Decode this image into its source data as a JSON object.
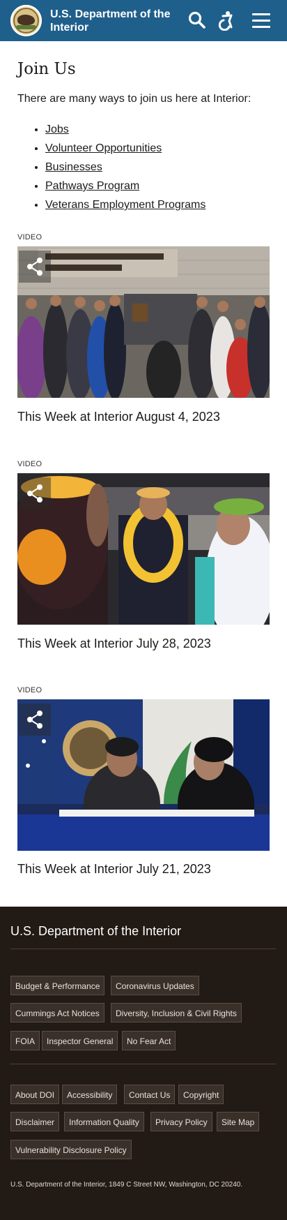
{
  "header": {
    "title": "U.S. Department of the Interior",
    "icons": [
      "seal-logo",
      "search-icon",
      "accessibility-icon",
      "menu-icon"
    ],
    "color": "#1f5f8b"
  },
  "main": {
    "heading": "Join Us",
    "intro": "There are many ways to join us here at Interior:",
    "links": [
      "Jobs",
      "Volunteer Opportunities",
      "Businesses",
      "Pathways Program",
      "Veterans Employment Programs"
    ]
  },
  "videos": [
    {
      "label": "VIDEO",
      "title": "This Week at Interior August 4, 2023"
    },
    {
      "label": "VIDEO",
      "title": "This Week at Interior July 28, 2023"
    },
    {
      "label": "VIDEO",
      "title": "This Week at Interior July 21, 2023"
    }
  ],
  "footer": {
    "title": "U.S. Department of the Interior",
    "group1": [
      "Budget & Performance",
      "Coronavirus Updates",
      "Cummings Act Notices",
      "Diversity, Inclusion & Civil Rights",
      "FOIA",
      "Inspector General",
      "No Fear Act"
    ],
    "group2": [
      "About DOI",
      "Accessibility",
      "Contact Us",
      "Copyright",
      "Disclaimer",
      "Information Quality",
      "Privacy Policy",
      "Site Map",
      "Vulnerability Disclosure Policy"
    ],
    "address": "U.S. Department of the Interior, 1849 C Street NW, Washington, DC 20240.",
    "color": "#221a14"
  }
}
